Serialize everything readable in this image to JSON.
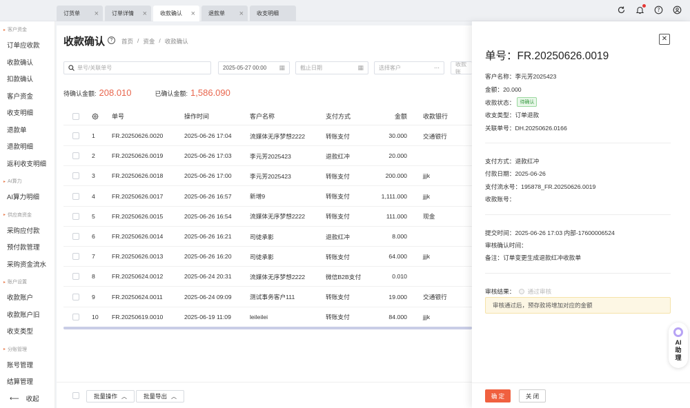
{
  "tabs": [
    {
      "label": "订货单",
      "active": false
    },
    {
      "label": "订单详情",
      "active": false
    },
    {
      "label": "收款确认",
      "active": true
    },
    {
      "label": "退款单",
      "active": false
    },
    {
      "label": "收支明细",
      "active": false
    }
  ],
  "sidebar": {
    "groups": [
      {
        "title": "客户资金",
        "items": [
          "订单应收款",
          "收款确认",
          "扣款确认",
          "客户资金",
          "收支明细",
          "退款单",
          "退款明细",
          "返利收支明细"
        ]
      },
      {
        "title": "AI算力",
        "items": [
          "AI算力明细"
        ]
      },
      {
        "title": "供应商资金",
        "items": [
          "采购应付款",
          "预付款管理",
          "采购资金流水"
        ]
      },
      {
        "title": "账户设置",
        "items": [
          "收款账户",
          "收款账户旧",
          "收支类型"
        ]
      },
      {
        "title": "分账管理",
        "items": [
          "账号管理",
          "结算管理"
        ]
      }
    ],
    "collapse_label": "收起"
  },
  "page": {
    "title": "收款确认",
    "breadcrumb": [
      "首页",
      "/",
      "资金",
      "/",
      "收款确认"
    ]
  },
  "filters": {
    "search_placeholder": "单号/关联单号",
    "start_date": "2025-05-27 00:00",
    "end_date_placeholder": "截止日期",
    "customer_placeholder": "选择客户",
    "account_placeholder": "收款账"
  },
  "stats": {
    "pending_label": "待确认金额:",
    "pending_value": "208.010",
    "confirmed_label": "已确认金额:",
    "confirmed_value": "1,586.090"
  },
  "table": {
    "headers": [
      "单号",
      "操作时间",
      "客户名称",
      "支付方式",
      "金额",
      "收款银行"
    ],
    "rows": [
      [
        "1",
        "FR.20250626.0020",
        "2025-06-26 17:04",
        "流媒体无序梦想2222",
        "转账支付",
        "30.000",
        "交通银行"
      ],
      [
        "2",
        "FR.20250626.0019",
        "2025-06-26 17:03",
        "李元芳2025423",
        "退款红冲",
        "20.000",
        ""
      ],
      [
        "3",
        "FR.20250626.0018",
        "2025-06-26 17:00",
        "李元芳2025423",
        "转账支付",
        "200.000",
        "jjjk"
      ],
      [
        "4",
        "FR.20250626.0017",
        "2025-06-26 16:57",
        "新增9",
        "转账支付",
        "1,111.000",
        "jjjk"
      ],
      [
        "5",
        "FR.20250626.0015",
        "2025-06-26 16:54",
        "流媒体无序梦想2222",
        "转账支付",
        "111.000",
        "现金"
      ],
      [
        "6",
        "FR.20250626.0014",
        "2025-06-26 16:21",
        "司徒承影",
        "退款红冲",
        "8.000",
        ""
      ],
      [
        "7",
        "FR.20250626.0013",
        "2025-06-26 16:20",
        "司徒承影",
        "转账支付",
        "64.000",
        "jjjk"
      ],
      [
        "8",
        "FR.20250624.0012",
        "2025-06-24 20:31",
        "流媒体无序梦想2222",
        "微信B2B支付",
        "0.010",
        ""
      ],
      [
        "9",
        "FR.20250624.0011",
        "2025-06-24 09:09",
        "测试事务客户111",
        "转账支付",
        "19.000",
        "交通银行"
      ],
      [
        "10",
        "FR.20250619.0010",
        "2025-06-19 11:09",
        "leileilei",
        "转账支付",
        "84.000",
        "jjjk"
      ]
    ]
  },
  "bottom": {
    "batch_op": "批量操作",
    "batch_export": "批量导出"
  },
  "drawer": {
    "title": "单号：FR.20250626.0019",
    "customer": "客户名称：李元芳2025423",
    "amount": "金额：20.000",
    "status_label": "收款状态：",
    "status_badge": "待确认",
    "type": "收支类型：订单退款",
    "related": "关联单号：DH.20250626.0166",
    "pay_method": "支付方式：退款红冲",
    "pay_date": "付款日期：2025-06-26",
    "pay_serial": "支付流水号：195878_FR.20250626.0019",
    "account": "收款账号：",
    "submit_time": "提交时间：2025-06-26 17:03 内部-17600006524",
    "audit_time": "审核确认时间：",
    "remark": "备注：订单变更生成退款红冲收款单",
    "audit_result_label": "审核结果：",
    "audit_option": "通过审核",
    "notice": "审核通过后，预存款将增加对应的金额",
    "ok": "确 定",
    "close": "关 闭"
  },
  "ai_assistant": {
    "line1": "AI",
    "line2": "助",
    "line3": "理"
  },
  "colors": {
    "accent": "#f0603f",
    "highlight_value": "#e8654c",
    "badge_green": "#3a9b43"
  }
}
